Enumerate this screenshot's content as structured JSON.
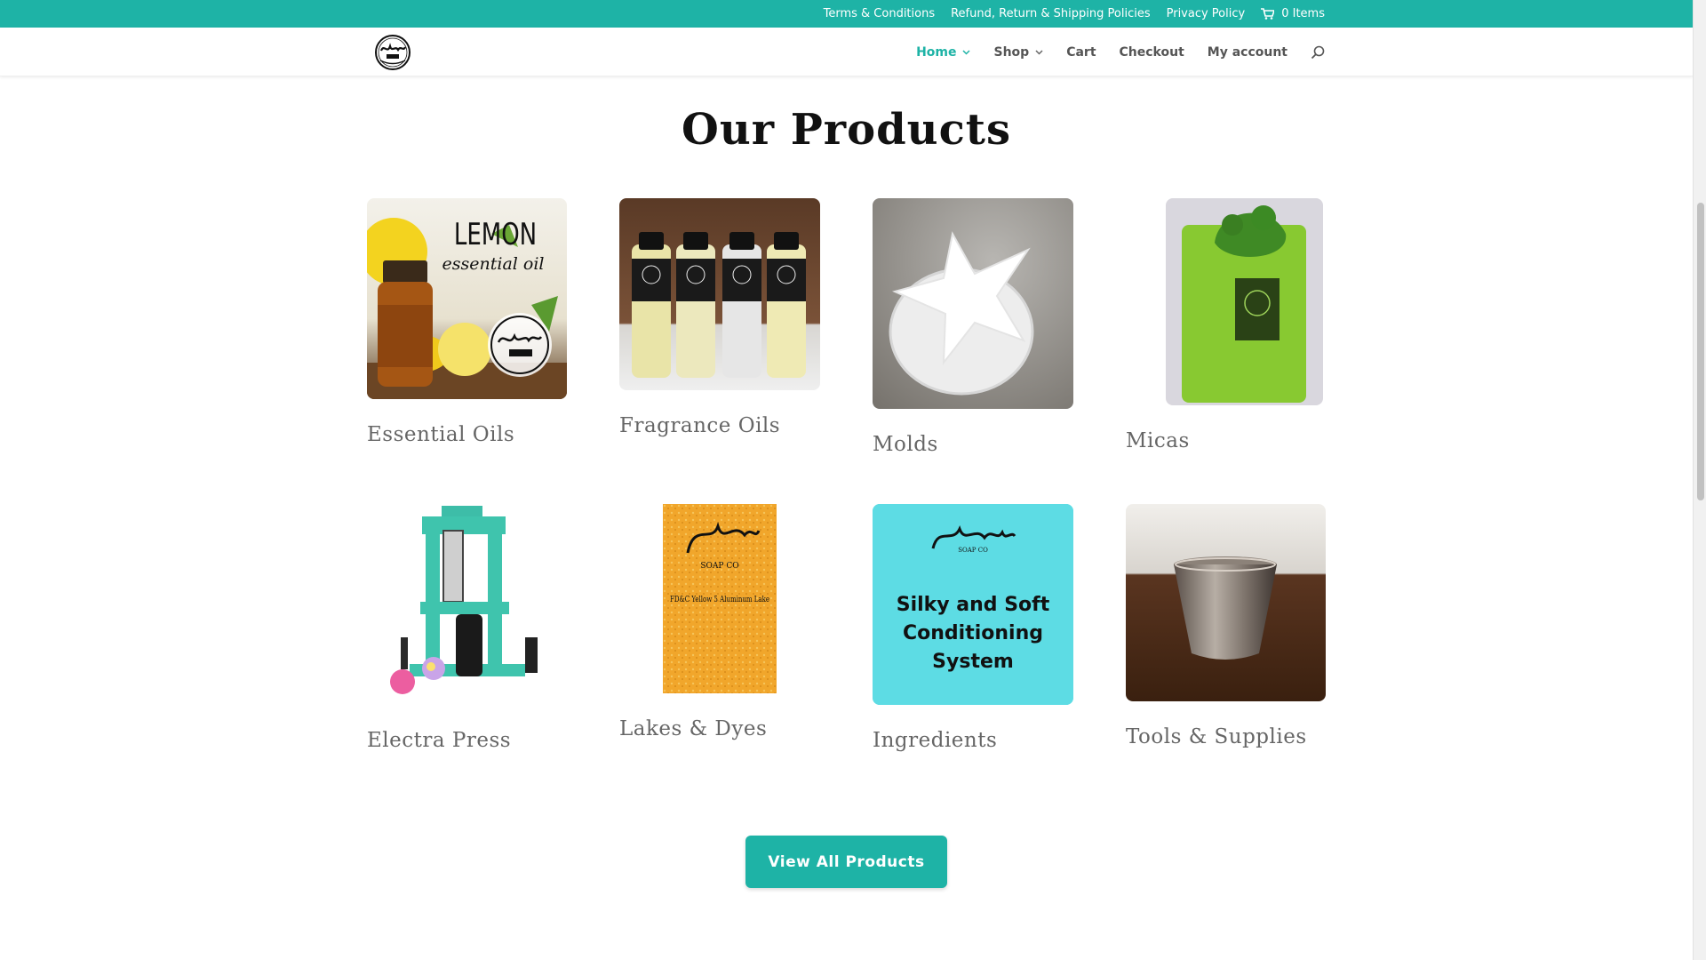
{
  "topbar": {
    "links": [
      "Terms & Conditions",
      "Refund, Return & Shipping Policies",
      "Privacy Policy"
    ],
    "cart_label": "0 Items"
  },
  "header": {
    "logo_text": "Muddy SOAP CO",
    "nav": [
      {
        "label": "Home",
        "active": true,
        "has_dropdown": true
      },
      {
        "label": "Shop",
        "active": false,
        "has_dropdown": true
      },
      {
        "label": "Cart",
        "active": false,
        "has_dropdown": false
      },
      {
        "label": "Checkout",
        "active": false,
        "has_dropdown": false
      },
      {
        "label": "My account",
        "active": false,
        "has_dropdown": false
      }
    ]
  },
  "main": {
    "title": "Our Products",
    "products": [
      {
        "name": "Essential Oils",
        "image_text_1": "LEMON",
        "image_text_2": "essential oil"
      },
      {
        "name": "Fragrance Oils"
      },
      {
        "name": "Molds"
      },
      {
        "name": "Micas"
      },
      {
        "name": "Electra Press"
      },
      {
        "name": "Lakes & Dyes",
        "image_text": "FD&C Yellow 5 Aluminum Lake"
      },
      {
        "name": "Ingredients",
        "image_text": "Silky and Soft Conditioning System"
      },
      {
        "name": "Tools & Supplies"
      }
    ],
    "view_all_label": "View All Products"
  },
  "colors": {
    "accent": "#1eb3a6",
    "ingredients_bg": "#5ddce4",
    "lakes_bg": "#f0a628"
  }
}
